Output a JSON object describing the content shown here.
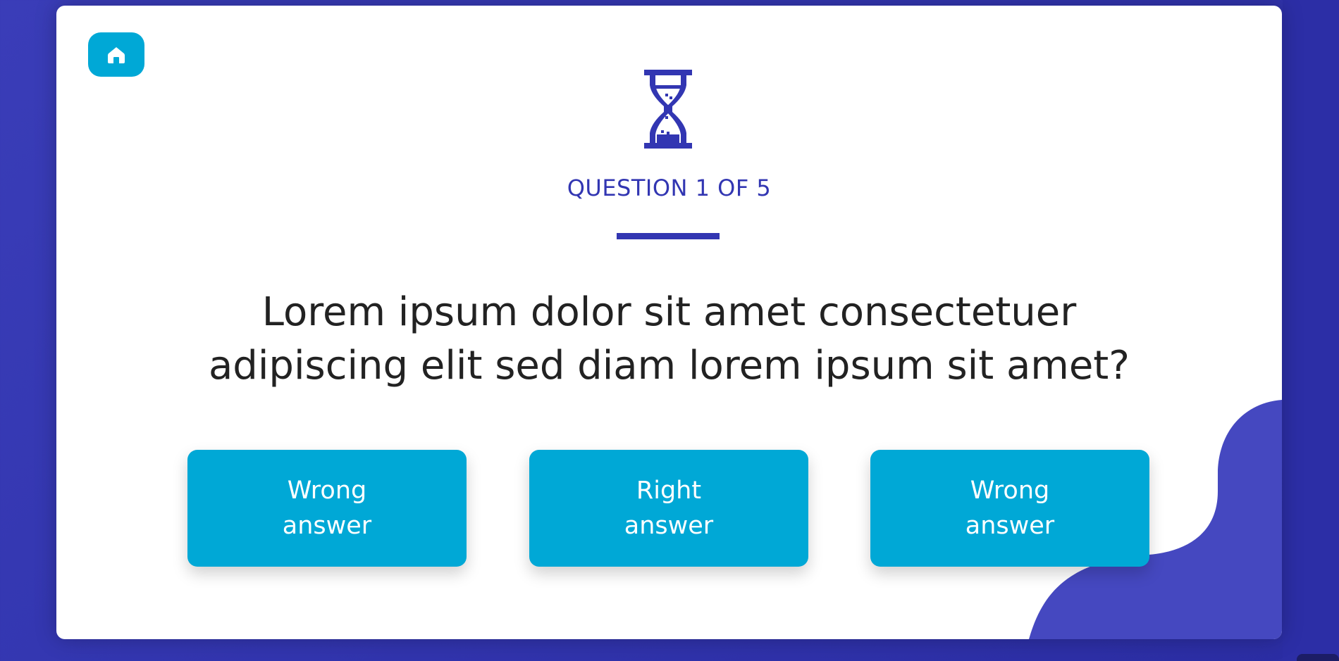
{
  "quiz": {
    "counter": "QUESTION 1 OF 5",
    "question": "Lorem ipsum dolor sit amet consectetuer adipiscing elit sed diam lorem ipsum sit amet?",
    "answers": [
      {
        "line1": "Wrong",
        "line2": "answer"
      },
      {
        "line1": "Right",
        "line2": "answer"
      },
      {
        "line1": "Wrong",
        "line2": "answer"
      }
    ]
  },
  "icons": {
    "home": "home-icon",
    "timer": "hourglass-icon"
  },
  "colors": {
    "background": "#3336b0",
    "accent": "#3236b2",
    "button": "#00a8d6",
    "blob": "#4548c0",
    "text": "#222222"
  }
}
